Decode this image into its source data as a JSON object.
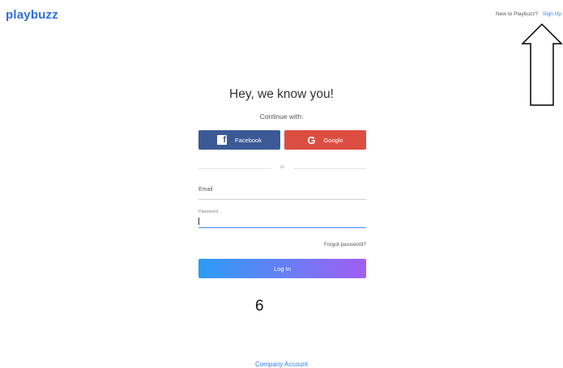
{
  "header": {
    "logo": "playbuzz",
    "new_to": "New to Playbuzz?",
    "signup_link": "Sign Up"
  },
  "form": {
    "title": "Hey, we know you!",
    "continue_with": "Continue with:",
    "facebook_label": "Facebook",
    "facebook_icon": "f",
    "google_label": "Google",
    "google_icon": "G",
    "or": "or",
    "email_label": "Email",
    "password_label": "Password",
    "forgot": "Forgot password?",
    "login_label": "Log In"
  },
  "annotation": {
    "page_number": "6"
  },
  "footer": {
    "company_account": "Company Account"
  },
  "colors": {
    "logo": "#2f6fe0",
    "facebook": "#3b5a95",
    "google": "#dc4e41",
    "link": "#2d7ff9",
    "login_gradient_start": "#2b9cf6",
    "login_gradient_end": "#a15ef3"
  },
  "icons": [
    "facebook-icon",
    "google-icon",
    "up-arrow-icon"
  ]
}
